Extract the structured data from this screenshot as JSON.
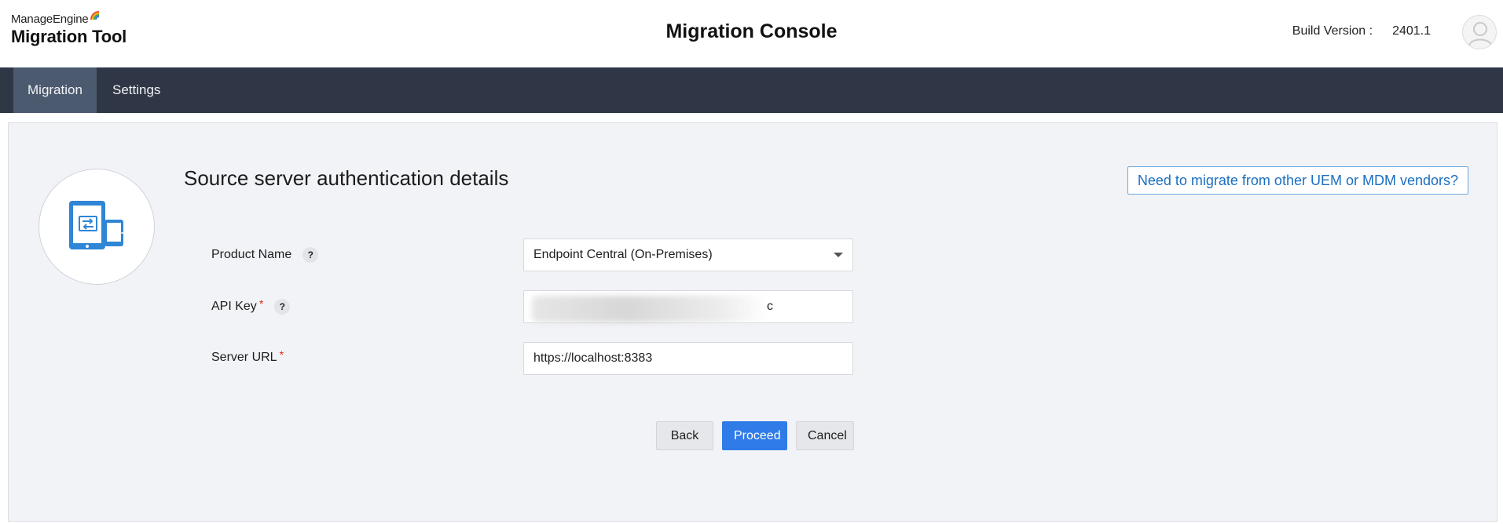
{
  "header": {
    "brand": "ManageEngine",
    "product": "Migration Tool",
    "title": "Migration Console",
    "build_label": "Build Version :",
    "build_value": "2401.1"
  },
  "nav": {
    "tabs": [
      {
        "label": "Migration",
        "active": true
      },
      {
        "label": "Settings",
        "active": false
      }
    ]
  },
  "form": {
    "title": "Source server authentication details",
    "vendor_link": "Need to migrate from other UEM or MDM vendors?",
    "product_name": {
      "label": "Product Name",
      "value": "Endpoint Central (On-Premises)"
    },
    "api_key": {
      "label": "API Key",
      "value": "c",
      "required": true
    },
    "server_url": {
      "label": "Server URL",
      "value": "https://localhost:8383",
      "required": true
    },
    "help_glyph": "?",
    "required_mark": "*"
  },
  "buttons": {
    "back": "Back",
    "proceed": "Proceed",
    "cancel": "Cancel"
  },
  "colors": {
    "nav_bg": "#2f3646",
    "nav_active": "#4c5a70",
    "primary": "#2f7be8",
    "link": "#1a6fc0",
    "icon_blue": "#2f85d6"
  },
  "icons": [
    "manageengine-arc-icon",
    "user-avatar-icon",
    "device-migration-icon",
    "help-icon",
    "dropdown-caret-icon"
  ]
}
